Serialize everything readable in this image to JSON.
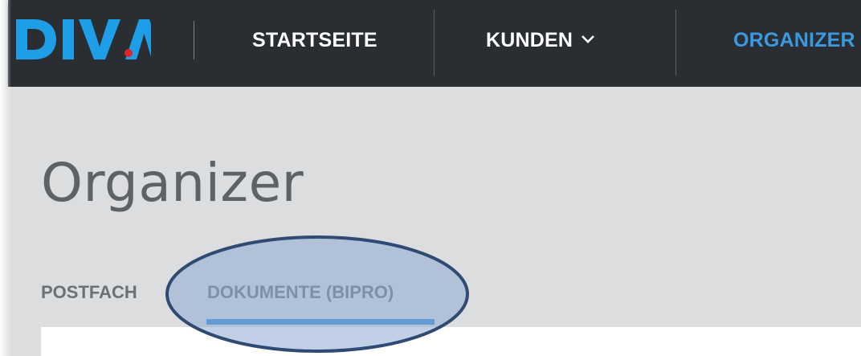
{
  "brand": {
    "logo_text": "DIVA",
    "logo_color": "#1e9ee6",
    "logo_dot_color": "#e0242b"
  },
  "navbar": {
    "items": [
      {
        "label": "STARTSEITE",
        "active": false
      },
      {
        "label": "KUNDEN",
        "has_dropdown": true,
        "active": false
      },
      {
        "label": "ORGANIZER",
        "active": true
      }
    ],
    "background": "#2a2e33",
    "active_color": "#3a9ae0"
  },
  "page": {
    "title": "Organizer"
  },
  "tabs": [
    {
      "label": "POSTFACH",
      "active": false
    },
    {
      "label": "DOKUMENTE (BIPRO)",
      "active": true
    }
  ],
  "colors": {
    "tab_underline": "#2e88d4",
    "highlight_fill": "#8ea9d1",
    "highlight_stroke": "#2f4a73"
  }
}
